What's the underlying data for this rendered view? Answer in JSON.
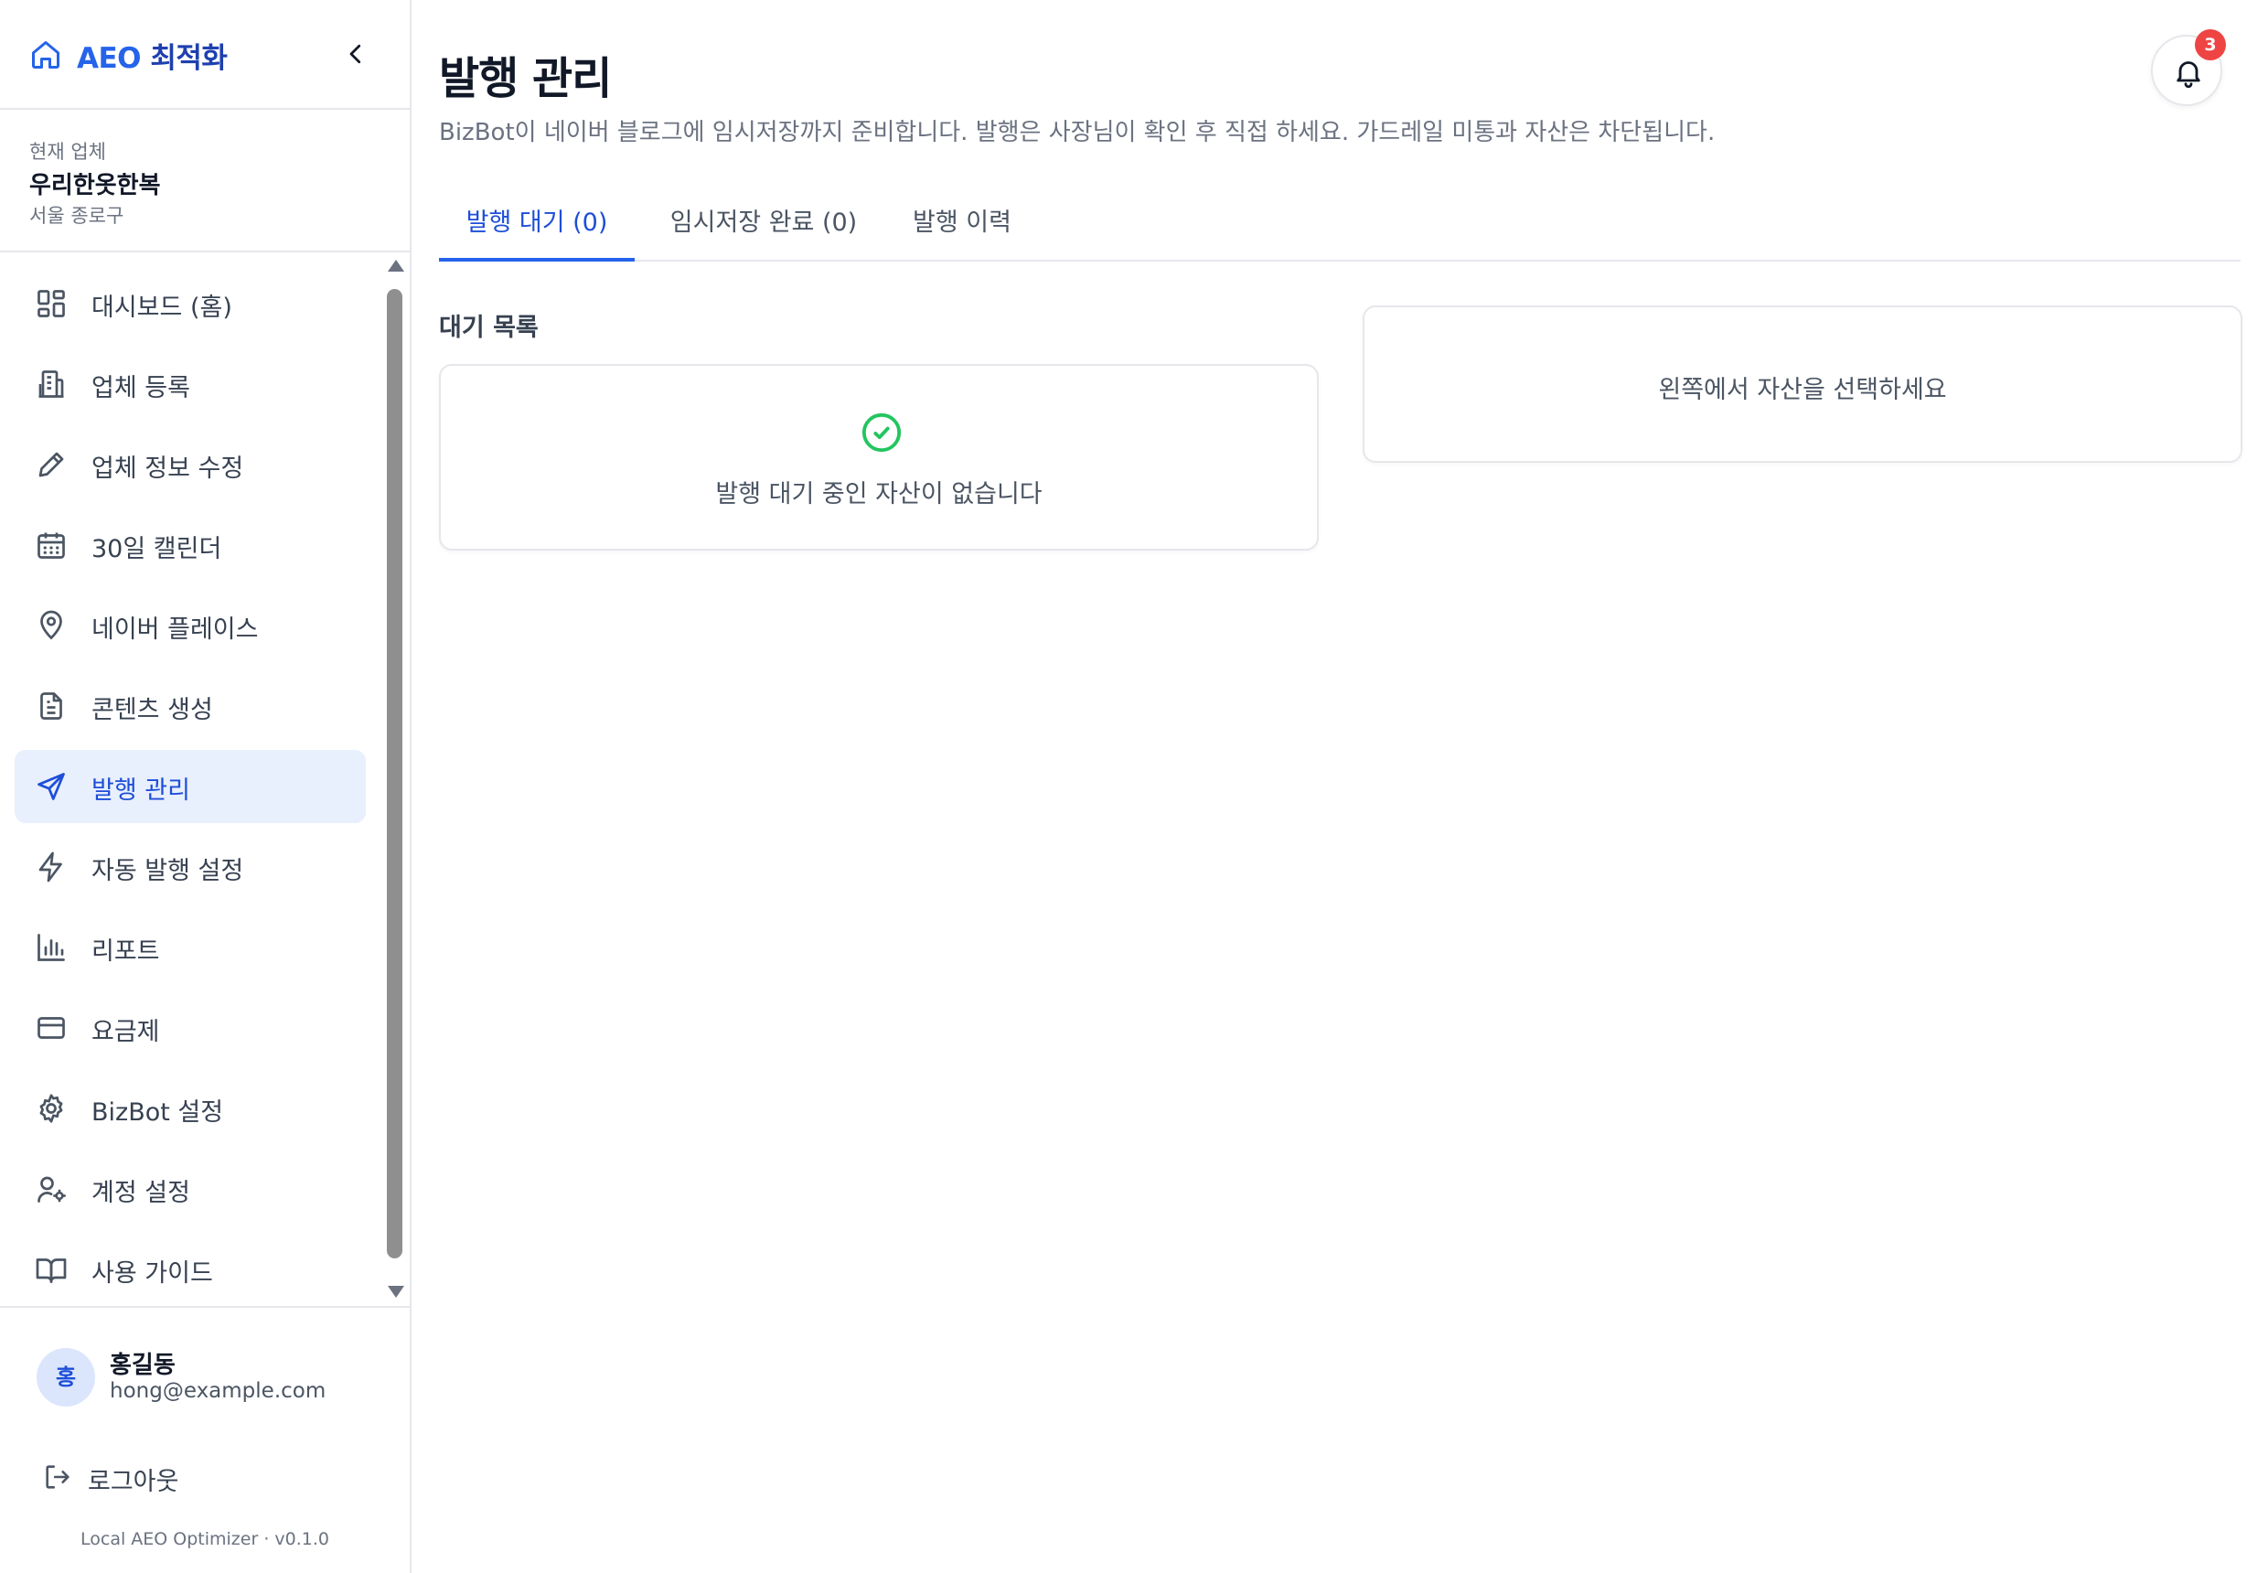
{
  "sidebar": {
    "brand": {
      "prefix": "AEO",
      "suffix": " 최적화"
    },
    "business": {
      "label": "현재 업체",
      "name": "우리한옷한복",
      "location": "서울 종로구"
    },
    "items": [
      {
        "label": "대시보드 (홈)",
        "icon": "grid-icon"
      },
      {
        "label": "업체 등록",
        "icon": "building-icon"
      },
      {
        "label": "업체 정보 수정",
        "icon": "pencil-icon"
      },
      {
        "label": "30일 캘린더",
        "icon": "calendar-icon"
      },
      {
        "label": "네이버 플레이스",
        "icon": "map-pin-icon"
      },
      {
        "label": "콘텐츠 생성",
        "icon": "document-icon"
      },
      {
        "label": "발행 관리",
        "icon": "send-icon",
        "active": true
      },
      {
        "label": "자동 발행 설정",
        "icon": "bolt-icon"
      },
      {
        "label": "리포트",
        "icon": "bar-chart-icon"
      },
      {
        "label": "요금제",
        "icon": "credit-card-icon"
      },
      {
        "label": "BizBot 설정",
        "icon": "gear-icon"
      },
      {
        "label": "계정 설정",
        "icon": "user-cog-icon"
      },
      {
        "label": "사용 가이드",
        "icon": "book-icon"
      }
    ],
    "user": {
      "avatar": "홍",
      "name": "홍길동",
      "email": "hong@example.com"
    },
    "logout_label": "로그아웃",
    "version": "Local AEO Optimizer · v0.1.0"
  },
  "header": {
    "title": "발행 관리",
    "description": "BizBot이 네이버 블로그에 임시저장까지 준비합니다. 발행은 사장님이 확인 후 직접 하세요. 가드레일 미통과 자산은 차단됩니다.",
    "notification_count": "3"
  },
  "tabs": [
    {
      "label": "발행 대기 (0)",
      "active": true
    },
    {
      "label": "임시저장 완료 (0)"
    },
    {
      "label": "발행 이력"
    }
  ],
  "main": {
    "section_title": "대기 목록",
    "empty_message": "발행 대기 중인 자산이 없습니다",
    "select_prompt": "왼쪽에서 자산을 선택하세요"
  },
  "colors": {
    "accent": "#2563eb",
    "active_bg": "#e8effd",
    "success": "#22c55e",
    "badge": "#ef4444"
  }
}
